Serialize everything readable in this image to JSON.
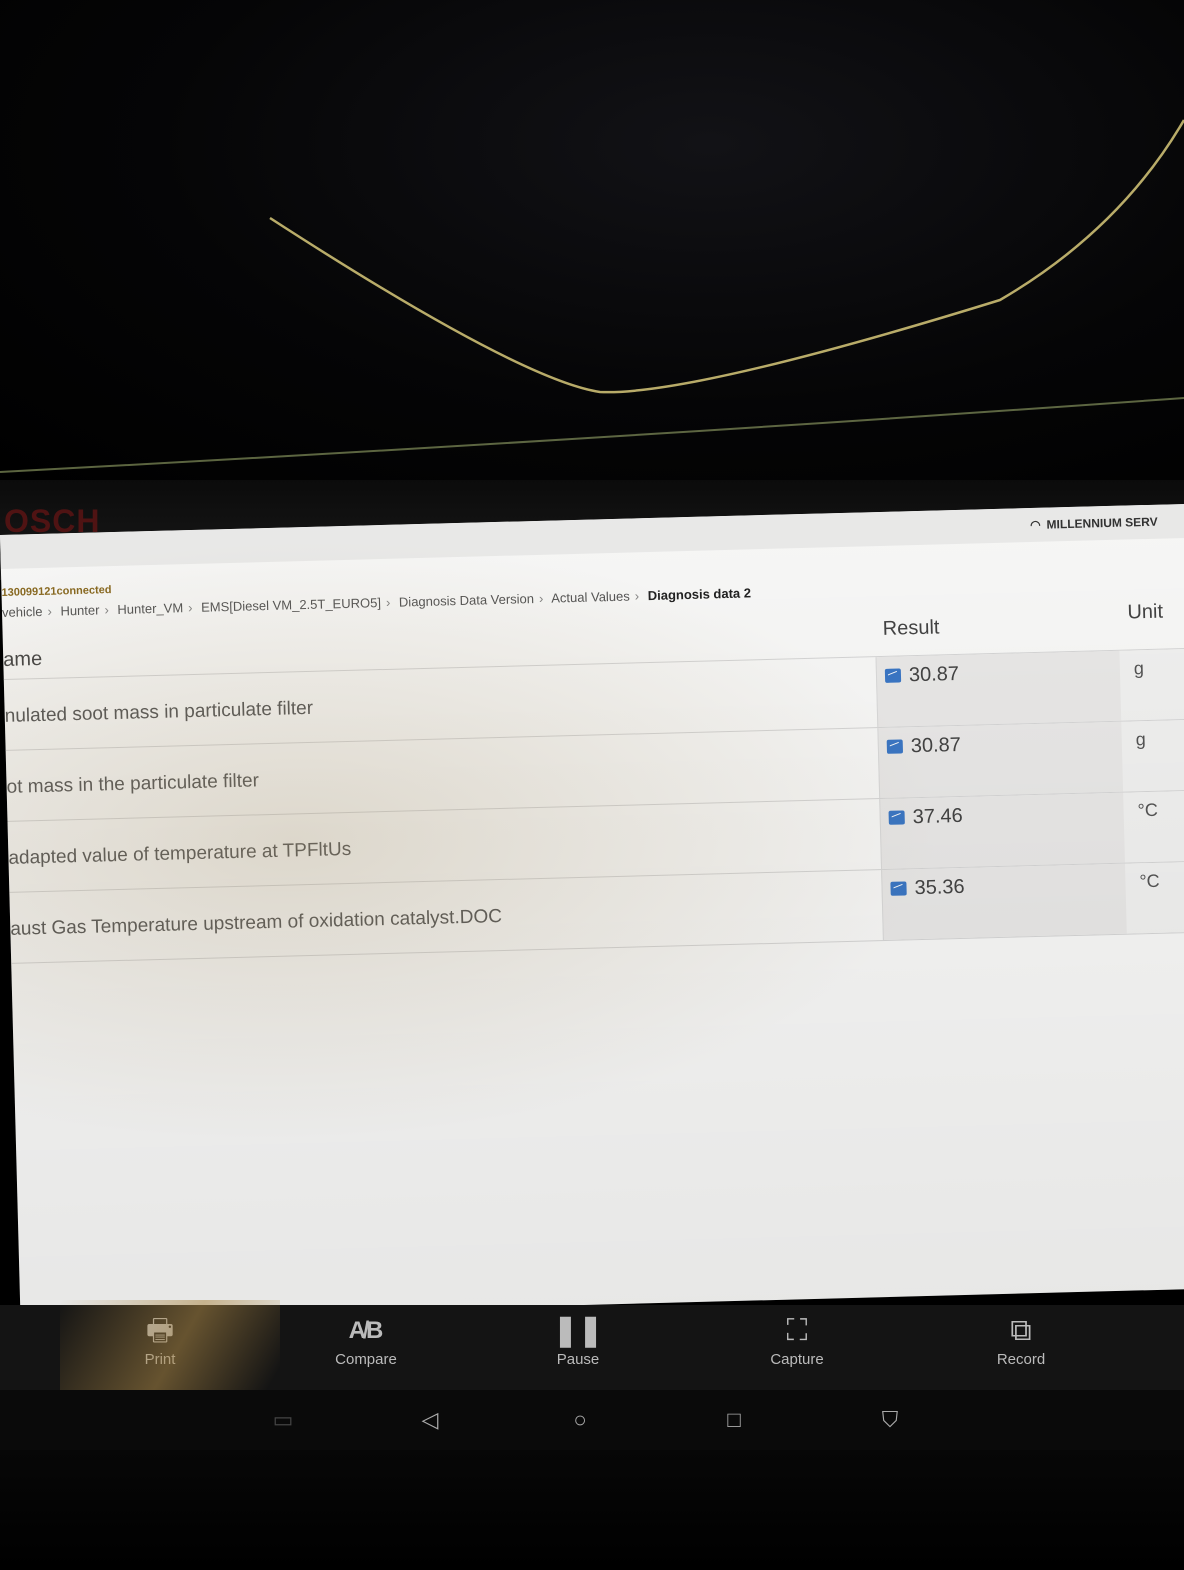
{
  "header": {
    "brand": "OSCH",
    "wifi_network": "MILLENNIUM SERV"
  },
  "connection_status": "130099121connected",
  "breadcrumb": [
    "vehicle",
    "Hunter",
    "Hunter_VM",
    "EMS[Diesel VM_2.5T_EURO5]",
    "Diagnosis Data Version",
    "Actual Values",
    "Diagnosis data 2"
  ],
  "table": {
    "headers": {
      "name": "ame",
      "result": "Result",
      "unit": "Unit"
    },
    "rows": [
      {
        "name": "nulated soot mass in particulate filter",
        "result": "30.87",
        "unit": "g"
      },
      {
        "name": "ot mass in the particulate filter",
        "result": "30.87",
        "unit": "g"
      },
      {
        "name": "adapted value of temperature at TPFltUs",
        "result": "37.46",
        "unit": "°C"
      },
      {
        "name": "aust Gas Temperature upstream of oxidation catalyst.DOC",
        "result": "35.36",
        "unit": "°C"
      }
    ]
  },
  "toolbar": {
    "print": "Print",
    "compare": "Compare",
    "pause": "Pause",
    "capture": "Capture",
    "record": "Record"
  },
  "icons": {
    "print": "printer-icon",
    "compare": "compare-ab-icon",
    "pause": "pause-icon",
    "capture": "capture-frame-icon",
    "record": "record-icon",
    "chart": "chart-icon"
  },
  "colors": {
    "accent": "#3b78c7",
    "brand": "#5a1414",
    "toolbar_bg": "#141414"
  }
}
